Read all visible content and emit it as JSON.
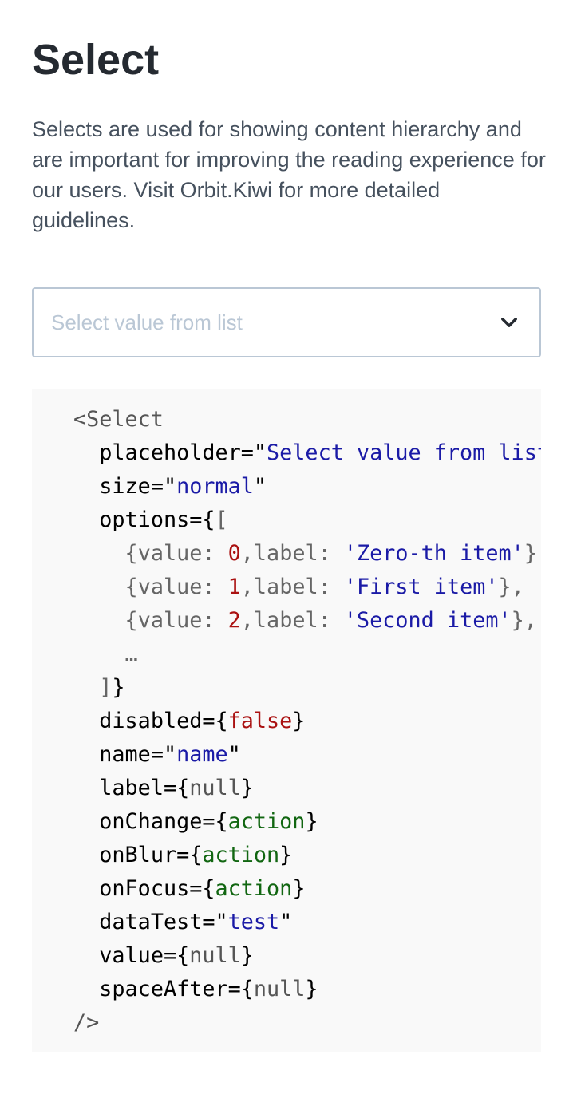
{
  "page": {
    "title": "Select",
    "description": "Selects are used for showing content hierarchy and are important for improving the reading experience for our users. Visit Orbit.Kiwi for more detailed guidelines."
  },
  "select": {
    "placeholder": "Select value from list",
    "chevron_icon": "chevron-down-icon"
  },
  "code": {
    "open_tag": "<Select",
    "placeholder_attr": "placeholder=",
    "placeholder_value": "Select value from list",
    "size_attr": "size=",
    "size_value": "normal",
    "options_attr": "options={",
    "options": [
      {
        "key_value": "value:",
        "value": "0",
        "key_label": "label:",
        "label": "'Zero-th item'"
      },
      {
        "key_value": "value:",
        "value": "1",
        "key_label": "label:",
        "label": "'First item'"
      },
      {
        "key_value": "value:",
        "value": "2",
        "key_label": "label:",
        "label": "'Second item'"
      }
    ],
    "ellipsis": "…",
    "disabled_attr": "disabled=",
    "disabled_value": "false",
    "name_attr": "name=",
    "name_value": "name",
    "label_attr": "label=",
    "label_value": "null",
    "onchange_attr": "onChange=",
    "onchange_value": "action",
    "onblur_attr": "onBlur=",
    "onblur_value": "action",
    "onfocus_attr": "onFocus=",
    "onfocus_value": "action",
    "datatest_attr": "dataTest=",
    "datatest_value": "test",
    "value_attr": "value=",
    "value_value": "null",
    "spaceafter_attr": "spaceAfter=",
    "spaceafter_value": "null",
    "close_tag": "/>"
  }
}
